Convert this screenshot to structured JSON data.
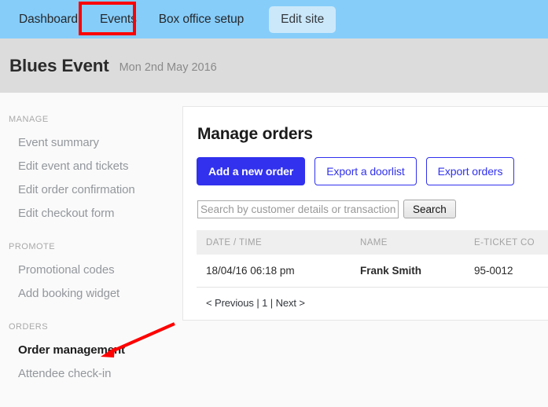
{
  "topnav": {
    "items": [
      {
        "label": "Dashboard",
        "name": "nav-dashboard"
      },
      {
        "label": "Events",
        "name": "nav-events"
      },
      {
        "label": "Box office setup",
        "name": "nav-box-office-setup"
      }
    ],
    "edit_site_label": "Edit site"
  },
  "event_header": {
    "title": "Blues Event",
    "date": "Mon 2nd May 2016"
  },
  "sidebar": {
    "groups": [
      {
        "section": "MANAGE",
        "items": [
          {
            "label": "Event summary",
            "active": false
          },
          {
            "label": "Edit event and tickets",
            "active": false
          },
          {
            "label": "Edit order confirmation",
            "active": false
          },
          {
            "label": "Edit checkout form",
            "active": false
          }
        ]
      },
      {
        "section": "PROMOTE",
        "items": [
          {
            "label": "Promotional codes",
            "active": false
          },
          {
            "label": "Add booking widget",
            "active": false
          }
        ]
      },
      {
        "section": "ORDERS",
        "items": [
          {
            "label": "Order management",
            "active": true
          },
          {
            "label": "Attendee check-in",
            "active": false
          }
        ]
      }
    ]
  },
  "panel": {
    "title": "Manage orders",
    "buttons": {
      "add_order": "Add a new order",
      "export_doorlist": "Export a doorlist",
      "export_orders": "Export orders"
    },
    "search": {
      "placeholder": "Search by customer details or transaction id",
      "value": "",
      "button_label": "Search"
    },
    "table": {
      "headers": [
        "DATE / TIME",
        "NAME",
        "E-TICKET CO"
      ],
      "rows": [
        {
          "date_time": "18/04/16 06:18 pm",
          "name": "Frank Smith",
          "eticket_code": "95-0012"
        }
      ]
    },
    "pagination": {
      "previous": "< Previous",
      "sep1": "|",
      "page": "1",
      "sep2": "|",
      "next": "Next >"
    }
  },
  "annotations": {
    "highlight_target": "Events",
    "arrow_target": "Order management",
    "color": "#ff0000"
  }
}
